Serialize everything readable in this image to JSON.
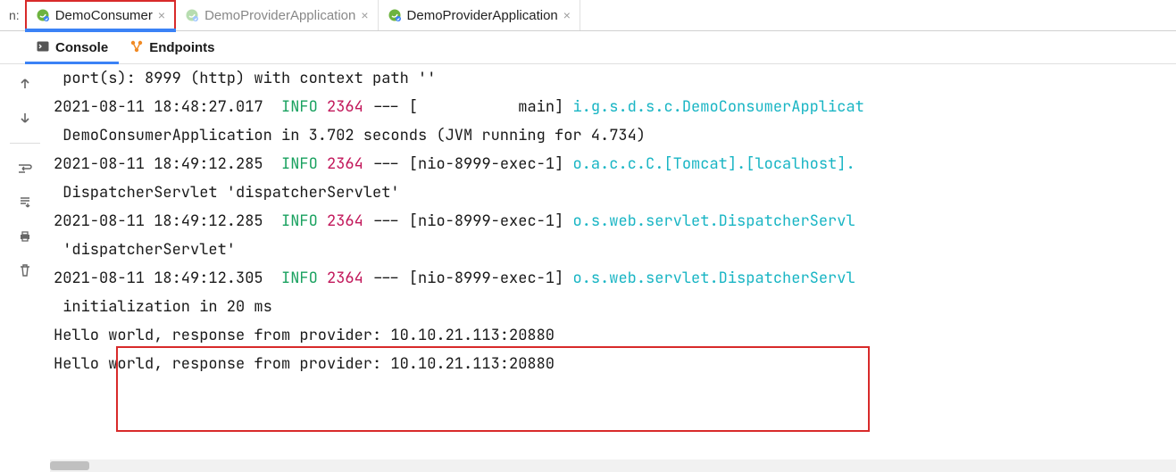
{
  "tabrow": {
    "prefix": "n:",
    "tabs": [
      {
        "label": "DemoConsumer",
        "active": true
      },
      {
        "label": "DemoProviderApplication",
        "active": false
      },
      {
        "label": "DemoProviderApplication",
        "active": false
      }
    ]
  },
  "toolrow": {
    "tools": [
      {
        "label": "Console",
        "active": true,
        "icon": "terminal"
      },
      {
        "label": "Endpoints",
        "active": false,
        "icon": "endpoints"
      }
    ]
  },
  "gutter": {
    "items": [
      {
        "name": "up-icon"
      },
      {
        "name": "down-icon"
      },
      {
        "sep": true
      },
      {
        "name": "softwrap-icon"
      },
      {
        "name": "scroll-end-icon"
      },
      {
        "name": "print-icon"
      },
      {
        "name": "trash-icon"
      }
    ]
  },
  "log": {
    "lines": [
      {
        "indent": true,
        "text": "port(s): 8999 (http) with context path ''"
      },
      {
        "ts": "2021-08-11 18:48:27.017",
        "level": "INFO",
        "pid": "2364",
        "thread": "[           main]",
        "logger": "i.g.s.d.s.c.DemoConsumerApplicat"
      },
      {
        "indent": true,
        "text": "DemoConsumerApplication in 3.702 seconds (JVM running for 4.734)"
      },
      {
        "ts": "2021-08-11 18:49:12.285",
        "level": "INFO",
        "pid": "2364",
        "thread": "[nio-8999-exec-1]",
        "logger": "o.a.c.c.C.[Tomcat].[localhost]."
      },
      {
        "indent": true,
        "text": "DispatcherServlet 'dispatcherServlet'"
      },
      {
        "ts": "2021-08-11 18:49:12.285",
        "level": "INFO",
        "pid": "2364",
        "thread": "[nio-8999-exec-1]",
        "logger": "o.s.web.servlet.DispatcherServl"
      },
      {
        "indent": true,
        "text": "'dispatcherServlet'"
      },
      {
        "ts": "2021-08-11 18:49:12.305",
        "level": "INFO",
        "pid": "2364",
        "thread": "[nio-8999-exec-1]",
        "logger": "o.s.web.servlet.DispatcherServl"
      },
      {
        "indent": true,
        "text": "initialization in 20 ms"
      },
      {
        "raw": "Hello world, response from provider: 10.10.21.113:20880"
      },
      {
        "raw": "Hello world, response from provider: 10.10.21.113:20880"
      }
    ]
  }
}
